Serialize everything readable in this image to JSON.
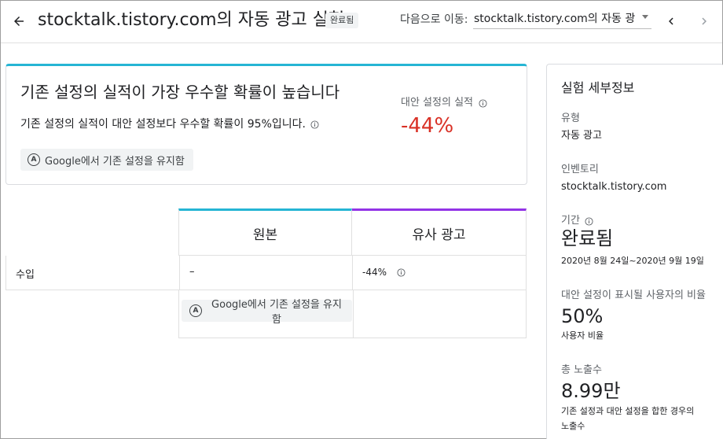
{
  "header": {
    "title": "stocktalk.tistory.com의 자동 광고 실험",
    "status": "완료됨",
    "goto_label": "다음으로 이동:",
    "goto_value": "stocktalk.tistory.com의 자동 광..."
  },
  "summary": {
    "title": "기존 설정의 실적이 가장 우수할 확률이 높습니다",
    "description": "기존 설정의 실적이 대안 설정보다 우수할 확률이 95%입니다.",
    "action_chip": "Google에서 기존 설정을 유지함",
    "perf_label": "대안 설정의 실적",
    "perf_value": "-44%",
    "perf_color": "#d93025",
    "accent_color": "#26b5d4"
  },
  "comparison": {
    "columns": [
      "원본",
      "유사 광고"
    ],
    "column_colors": [
      "#26b5d4",
      "#9334e6"
    ],
    "rows": [
      {
        "label": "수입",
        "original": "–",
        "variant": "-44%"
      }
    ],
    "action_chip": "Google에서 기존 설정을 유지함"
  },
  "details": {
    "title": "실험 세부정보",
    "type_label": "유형",
    "type_value": "자동 광고",
    "inventory_label": "인벤토리",
    "inventory_value": "stocktalk.tistory.com",
    "period_label": "기간",
    "period_value": "완료됨",
    "period_dates": "2020년 8월 24일~2020년 9월 19일",
    "ratio_label": "대안 설정이 표시될 사용자의 비율",
    "ratio_value": "50%",
    "ratio_sub": "사용자 비율",
    "impressions_label": "총 노출수",
    "impressions_value": "8.99만",
    "impressions_sub_1": "기존 설정과 대안 설정을 합한 경우의",
    "impressions_sub_2": "노출수"
  }
}
